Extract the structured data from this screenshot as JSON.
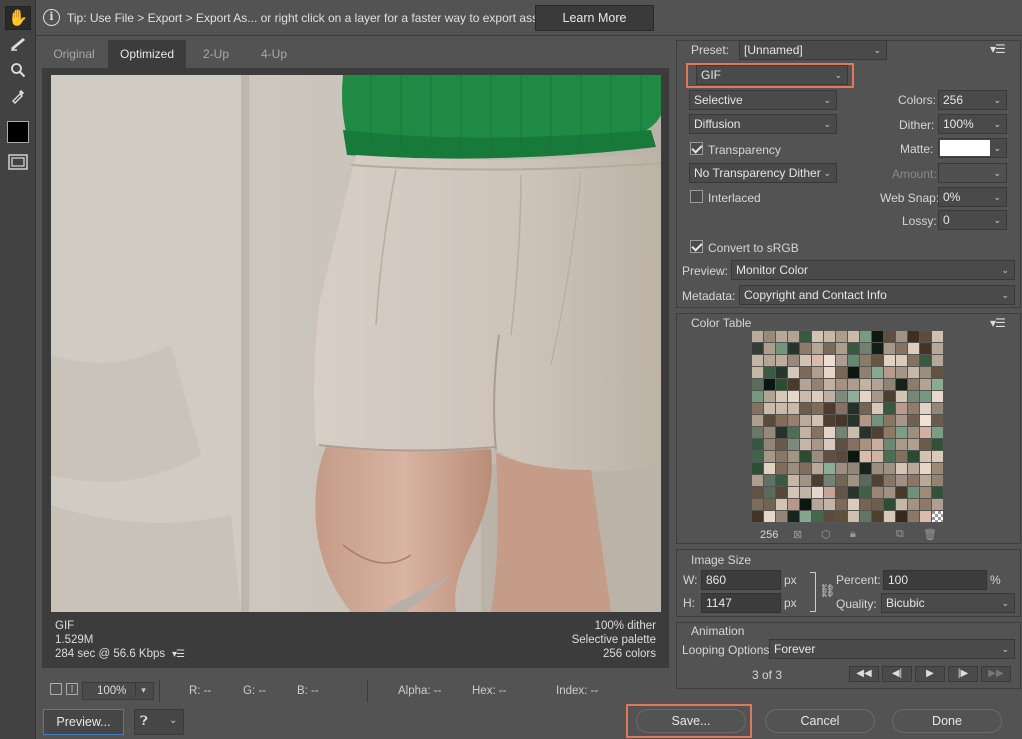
{
  "tip": {
    "text": "Tip: Use File > Export > Export As...  or right click on a layer for a faster way to export assets",
    "learn_more": "Learn More"
  },
  "tabs": [
    "Original",
    "Optimized",
    "2-Up",
    "4-Up"
  ],
  "preview_info": {
    "format": "GIF",
    "size": "1.529M",
    "time": "284 sec @ 56.6 Kbps",
    "dither": "100% dither",
    "palette": "Selective palette",
    "colors": "256 colors"
  },
  "status": {
    "zoom": "100%",
    "r": "R: --",
    "g": "G: --",
    "b": "B: --",
    "alpha": "Alpha: --",
    "hex": "Hex: --",
    "index": "Index: --"
  },
  "settings": {
    "preset_label": "Preset:",
    "preset_value": "[Unnamed]",
    "format": "GIF",
    "reduction": "Selective",
    "dither_algo": "Diffusion",
    "transparency_label": "Transparency",
    "transparency_checked": true,
    "trans_dither": "No Transparency Dither",
    "interlaced_label": "Interlaced",
    "interlaced_checked": false,
    "colors_label": "Colors:",
    "colors_value": "256",
    "dither_label": "Dither:",
    "dither_value": "100%",
    "matte_label": "Matte:",
    "amount_label": "Amount:",
    "websnap_label": "Web Snap:",
    "websnap_value": "0%",
    "lossy_label": "Lossy:",
    "lossy_value": "0",
    "srgb_label": "Convert to sRGB",
    "srgb_checked": true,
    "preview_label": "Preview:",
    "preview_value": "Monitor Color",
    "metadata_label": "Metadata:",
    "metadata_value": "Copyright and Contact Info"
  },
  "color_table": {
    "title": "Color Table",
    "count": "256",
    "colors": [
      "#8a7766",
      "#a39585",
      "#1e2a22",
      "#6b5c4a",
      "#c8b8a8",
      "#94806c",
      "#5a4a3c",
      "#b8a898",
      "#7a9c84",
      "#3c5c44",
      "#d8c8b8",
      "#a8988c",
      "#6c7c6c",
      "#c8a898",
      "#e0d0c4",
      "#4c3c30"
    ]
  },
  "image_size": {
    "title": "Image Size",
    "w_label": "W:",
    "w_value": "860",
    "h_label": "H:",
    "h_value": "1147",
    "unit": "px",
    "percent_label": "Percent:",
    "percent_value": "100",
    "percent_unit": "%",
    "quality_label": "Quality:",
    "quality_value": "Bicubic"
  },
  "animation": {
    "title": "Animation",
    "looping_label": "Looping Options:",
    "looping_value": "Forever",
    "frame": "3 of 3"
  },
  "buttons": {
    "preview": "Preview...",
    "save": "Save...",
    "cancel": "Cancel",
    "done": "Done"
  },
  "colors": {
    "highlight": "#e0785a",
    "sweater": "#1f8a44",
    "shorts": "#cfc5bc",
    "wall": "#cdc8bf"
  }
}
